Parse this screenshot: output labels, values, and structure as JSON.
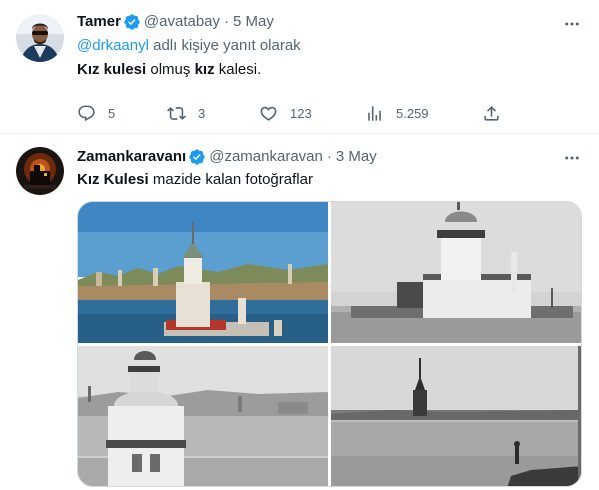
{
  "tweets": [
    {
      "author_name": "Tamer",
      "handle": "@avatabay",
      "date": "5 May",
      "reply_prefix": "@drkaanyl",
      "reply_suffix": " adlı kişiye yanıt olarak",
      "text_part1": "Kız kulesi",
      "text_part2": " olmuş ",
      "text_part3": "kız",
      "text_part4": " kalesi.",
      "stats": {
        "replies": "5",
        "retweets": "3",
        "likes": "123",
        "views": "5.259"
      }
    },
    {
      "author_name": "Zamankaravanı",
      "handle": "@zamankaravan",
      "date": "3 May",
      "text_part1": "Kız Kulesi",
      "text_part2": " mazide kalan fotoğraflar",
      "media": [
        "photo-color-tower",
        "photo-bw-tower-island",
        "photo-bw-tower-closeup",
        "photo-bw-tower-distant"
      ]
    }
  ],
  "colors": {
    "verified": "#1d9bf0",
    "link": "#1d9bf0",
    "muted": "#536471",
    "text": "#0f1419"
  },
  "icons": {
    "reply": "reply-icon",
    "retweet": "retweet-icon",
    "like": "heart-icon",
    "views": "views-icon",
    "share": "share-icon",
    "more": "more-icon",
    "verified": "verified-badge-icon"
  }
}
